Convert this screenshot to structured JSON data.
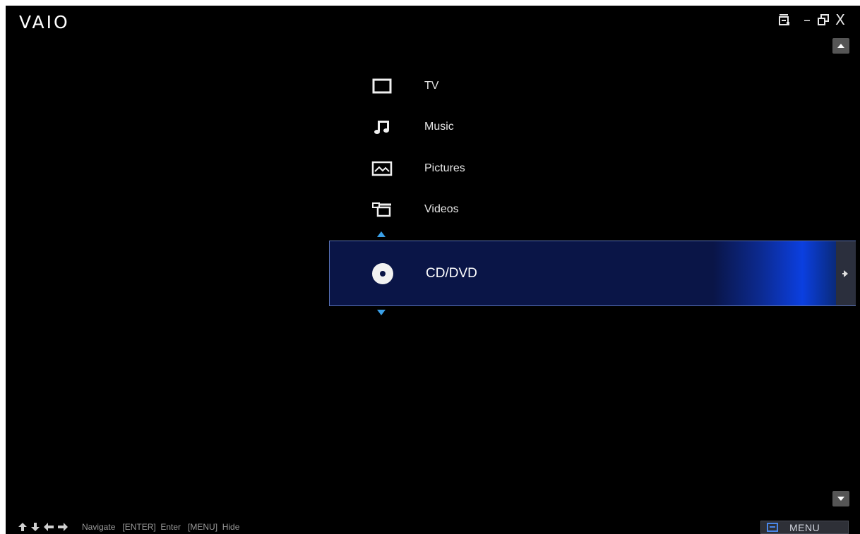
{
  "app": {
    "logo": "VAIO"
  },
  "window_controls": {
    "window_icon": "window-list-icon",
    "minimize": "–",
    "restore": "restore-icon",
    "close": "X"
  },
  "menu": {
    "items": [
      {
        "label": "TV",
        "icon": "tv-icon"
      },
      {
        "label": "Music",
        "icon": "music-note-icon"
      },
      {
        "label": "Pictures",
        "icon": "picture-icon"
      },
      {
        "label": "Videos",
        "icon": "video-camera-icon"
      }
    ],
    "selected": {
      "label": "CD/DVD",
      "icon": "disc-icon"
    }
  },
  "footer": {
    "hint": "Navigate   [ENTER]  Enter   [MENU]  Hide",
    "menu_button_label": "MENU"
  },
  "colors": {
    "background": "#000000",
    "selection_bar": "#0a1547",
    "selection_glow": "#0b3fe0",
    "accent_arrows": "#3aa0e8"
  }
}
